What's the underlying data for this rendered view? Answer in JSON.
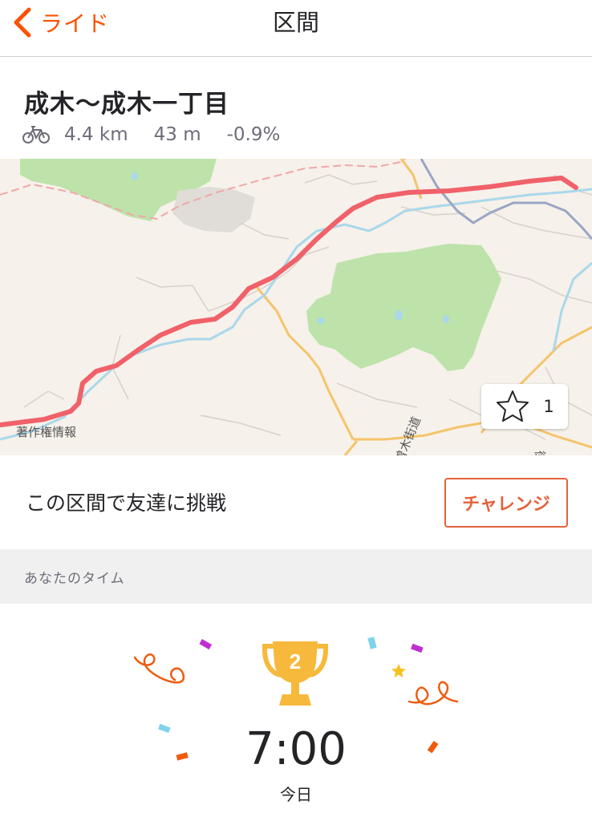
{
  "nav": {
    "back_label": "ライド",
    "title": "区間"
  },
  "segment": {
    "name": "成木〜成木一丁目",
    "distance": "4.4 km",
    "elevation": "43 m",
    "grade": "-0.9%"
  },
  "map": {
    "attribution": "著作権情報",
    "road_label_1": "小曽木街道",
    "road_label_2": "街道",
    "star_count": "1"
  },
  "challenge": {
    "text": "この区間で友達に挑戦",
    "button_label": "チャレンジ"
  },
  "your_time": {
    "header": "あなたのタイム",
    "rank": "2",
    "time": "7:00",
    "date": "今日"
  },
  "colors": {
    "accent": "#fc5200",
    "route": "#f0616a",
    "park": "#b9e3a5",
    "water": "#a9d8ea"
  }
}
